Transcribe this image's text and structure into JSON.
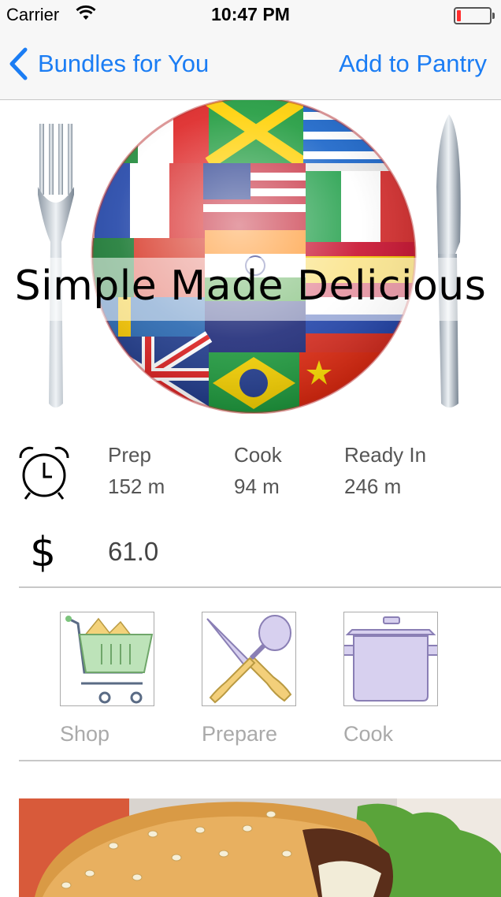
{
  "status_bar": {
    "carrier": "Carrier",
    "time": "10:47 PM"
  },
  "nav": {
    "back_label": "Bundles for You",
    "action_label": "Add to Pantry"
  },
  "hero": {
    "title": "Simple Made Delicious"
  },
  "timing": {
    "prep_label": "Prep",
    "prep_value": "152 m",
    "cook_label": "Cook",
    "cook_value": "94 m",
    "ready_label": "Ready In",
    "ready_value": "246 m"
  },
  "cost": {
    "symbol": "$",
    "value": "61.0"
  },
  "actions": [
    {
      "label": "Shop",
      "icon": "shopping-cart-icon"
    },
    {
      "label": "Prepare",
      "icon": "utensils-icon"
    },
    {
      "label": "Cook",
      "icon": "pot-icon"
    }
  ],
  "colors": {
    "accent": "#1b7df4",
    "muted": "#aaaaaa",
    "separator": "#c8c8c8"
  }
}
